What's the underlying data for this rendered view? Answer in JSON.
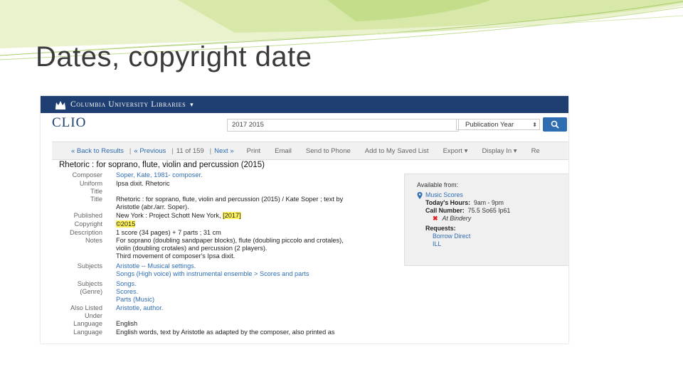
{
  "slide": {
    "title": "Dates, copyright date"
  },
  "screenshot": {
    "header": {
      "institution": "Columbia University Libraries",
      "caret": "▾"
    },
    "catalog_name": "CLIO",
    "search": {
      "query": "2017 2015",
      "field": "Publication Year"
    },
    "toolbar": {
      "back": "« Back to Results",
      "previous": "« Previous",
      "position": "11 of 159",
      "next": "Next »",
      "items": [
        "Print",
        "Email",
        "Send to Phone",
        "Add to My Saved List",
        "Export ▾",
        "Display In ▾",
        "Re"
      ]
    },
    "record": {
      "title": "Rhetoric : for soprano, flute, violin and percussion (2015)",
      "fields": [
        {
          "label": [
            "Composer"
          ],
          "values": [
            {
              "text": "Soper, Kate, 1981- composer.",
              "link": true
            }
          ]
        },
        {
          "label": [
            "Uniform",
            "Title"
          ],
          "values": [
            {
              "text": "Ipsa dixit. Rhetoric",
              "link": false
            }
          ]
        },
        {
          "label": [
            "Title"
          ],
          "values": [
            {
              "text": "Rhetoric : for soprano, flute, violin and percussion (2015) / Kate Soper ; text by",
              "link": false
            },
            {
              "text": "Aristotle (abr./arr. Soper).",
              "link": false
            }
          ]
        },
        {
          "label": [
            "Published"
          ],
          "values": [
            {
              "text": "New York : Project Schott New York, ",
              "link": false,
              "highlight": "[2017]"
            }
          ]
        },
        {
          "label": [
            "Copyright"
          ],
          "values": [
            {
              "text": "",
              "link": false,
              "highlight": "©2015"
            }
          ]
        },
        {
          "label": [
            "Description"
          ],
          "values": [
            {
              "text": "1 score (34 pages) + 7 parts ; 31 cm",
              "link": false
            }
          ]
        },
        {
          "label": [
            "Notes"
          ],
          "values": [
            {
              "text": "For soprano (doubling sandpaper blocks), flute (doubling piccolo and crotales),",
              "link": false
            },
            {
              "text": "violin (doubling crotales) and percussion (2 players).",
              "link": false
            },
            {
              "text": "Third movement of composer's Ipsa dixit.",
              "link": false
            }
          ]
        },
        {
          "label": [
            "Subjects"
          ],
          "values": [
            {
              "text": "Aristotle -- Musical settings.",
              "link": true
            },
            {
              "text": "Songs (High voice) with instrumental ensemble > Scores and parts",
              "link": true
            }
          ]
        },
        {
          "label": [
            "Subjects",
            "(Genre)"
          ],
          "values": [
            {
              "text": "Songs.",
              "link": true
            },
            {
              "text": "Scores.",
              "link": true
            },
            {
              "text": "Parts (Music)",
              "link": true
            }
          ]
        },
        {
          "label": [
            "Also Listed",
            "Under"
          ],
          "values": [
            {
              "text": "Aristotle, author.",
              "link": true
            }
          ]
        },
        {
          "label": [
            "Language"
          ],
          "values": [
            {
              "text": "English",
              "link": false
            }
          ]
        },
        {
          "label": [
            "Language"
          ],
          "values": [
            {
              "text": "English words, text by Aristotle as adapted by the composer, also printed as",
              "link": false
            }
          ]
        }
      ]
    },
    "availability": {
      "heading": "Available from:",
      "location": "Music Scores",
      "hours_label": "Today's Hours:",
      "hours": "9am - 9pm",
      "call_label": "Call Number:",
      "call_number": "75.5 So65 Ip61",
      "status": "At Bindery",
      "requests_label": "Requests:",
      "requests": [
        "Borrow Direct",
        "ILL"
      ]
    },
    "colors": {
      "header_bg": "#1f3f72",
      "link": "#2f6db3",
      "highlight": "#fff45c",
      "status_x": "#e02020"
    }
  }
}
